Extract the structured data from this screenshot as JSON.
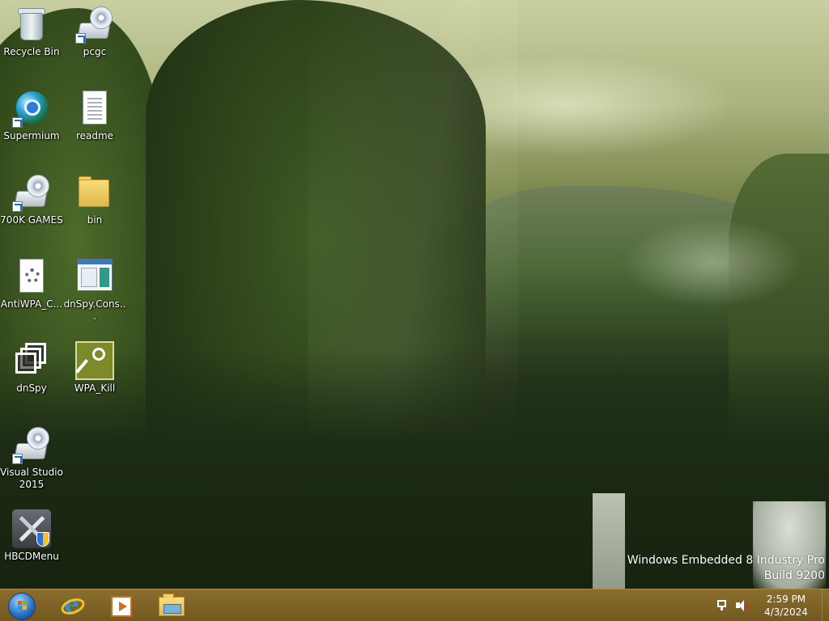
{
  "desktop_icons": [
    {
      "label": "Recycle Bin"
    },
    {
      "label": "pcgc"
    },
    {
      "label": "Supermium"
    },
    {
      "label": "readme"
    },
    {
      "label": "700K GAMES"
    },
    {
      "label": "bin"
    },
    {
      "label": "AntiWPA_C..."
    },
    {
      "label": "dnSpy.Cons..."
    },
    {
      "label": "dnSpy"
    },
    {
      "label": "WPA_Kill"
    },
    {
      "label": "Visual Studio 2015"
    },
    {
      "label": "HBCDMenu"
    }
  ],
  "watermark": {
    "line1": "Windows Embedded 8 Industry Pro",
    "line2": "Build 9200"
  },
  "taskbar": {
    "pinned": [
      {
        "name": "start-button",
        "icon": "windows-orb-icon"
      },
      {
        "name": "internet-explorer",
        "icon": "ie-icon"
      },
      {
        "name": "media-player",
        "icon": "media-player-icon"
      },
      {
        "name": "file-explorer",
        "icon": "folder-icon"
      }
    ],
    "tray": {
      "network_icon": "network-icon",
      "volume_icon": "volume-muted-icon",
      "time": "2:59 PM",
      "date": "4/3/2024"
    }
  },
  "colors": {
    "taskbar": "#7d6427",
    "watermark_text": "#ffffff",
    "label_text": "#ffffff"
  }
}
